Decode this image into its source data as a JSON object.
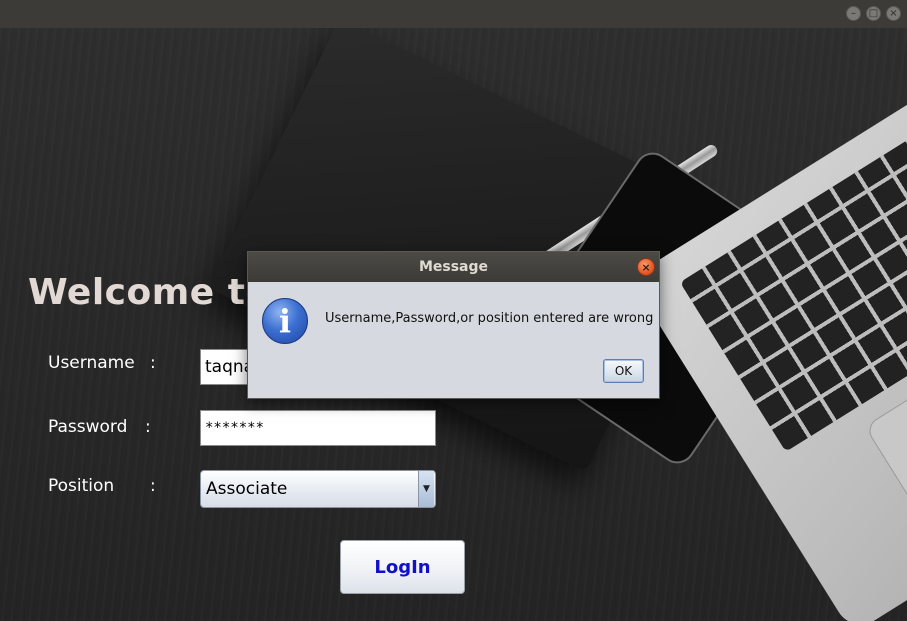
{
  "window": {
    "controls": {
      "minimize_icon": "minimize-icon",
      "maximize_icon": "maximize-icon",
      "close_icon": "close-icon",
      "minimize_glyph": "–",
      "maximize_glyph": "□",
      "close_glyph": "×"
    }
  },
  "login": {
    "welcome": "Welcome to",
    "username_label": "Username",
    "password_label": "Password",
    "position_label": "Position",
    "colon": ":",
    "username_value": "taqna",
    "password_value": "*******",
    "position_value": "Associate",
    "dropdown_arrow": "▼",
    "login_button": "LogIn"
  },
  "dialog": {
    "title": "Message",
    "close_glyph": "×",
    "info_glyph": "i",
    "message": "Username,Password,or position entered are wrong",
    "ok_button": "OK"
  },
  "colors": {
    "login_text": "#1010c8",
    "dialog_close": "#e35b28",
    "info_icon": "#3c6fd1"
  }
}
